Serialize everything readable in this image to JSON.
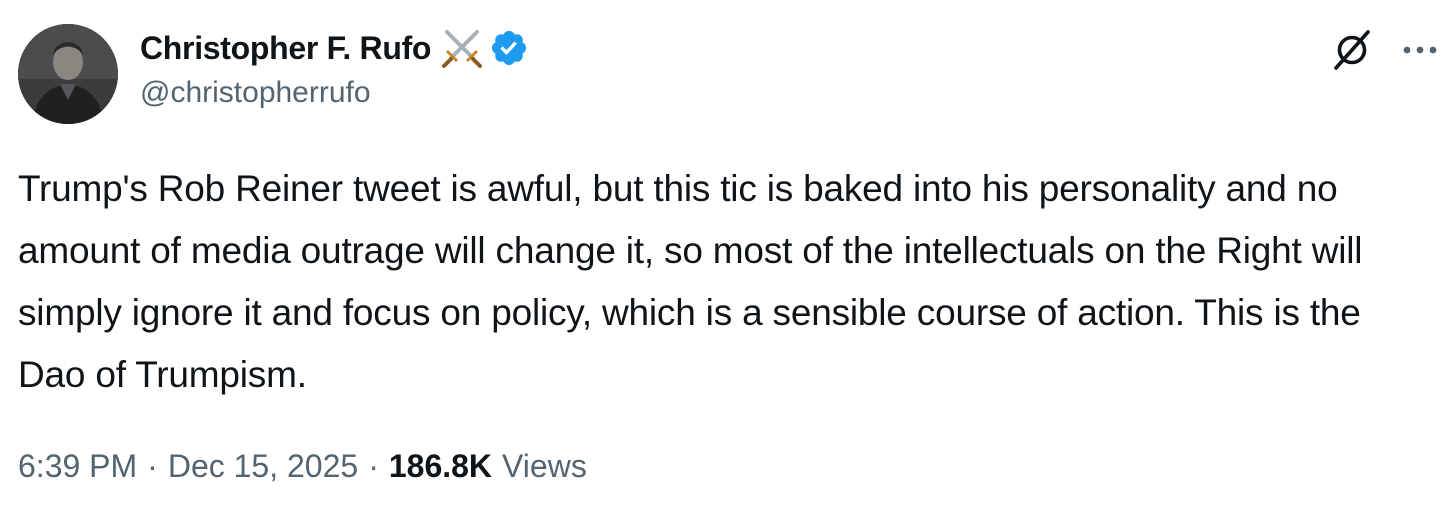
{
  "author": {
    "display_name": "Christopher F. Rufo",
    "handle": "@christopherrufo",
    "verified": true,
    "name_emoji": "crossed-swords-icon",
    "verified_color": "#1d9bf0"
  },
  "tweet": {
    "text": "Trump's Rob Reiner tweet is awful, but this tic is baked into his personality and no amount of media outrage will change it, so most of the intellectuals on the Right will simply ignore it and focus on policy, which is a sensible course of action. This is the Dao of Trumpism.",
    "time": "6:39 PM",
    "date": "Dec 15, 2025",
    "separator": "·",
    "views_count": "186.8K",
    "views_label": "Views"
  },
  "colors": {
    "text_primary": "#0f1419",
    "text_secondary": "#536471"
  },
  "icons": {
    "grok": "grok-icon",
    "more": "more-options-icon"
  }
}
